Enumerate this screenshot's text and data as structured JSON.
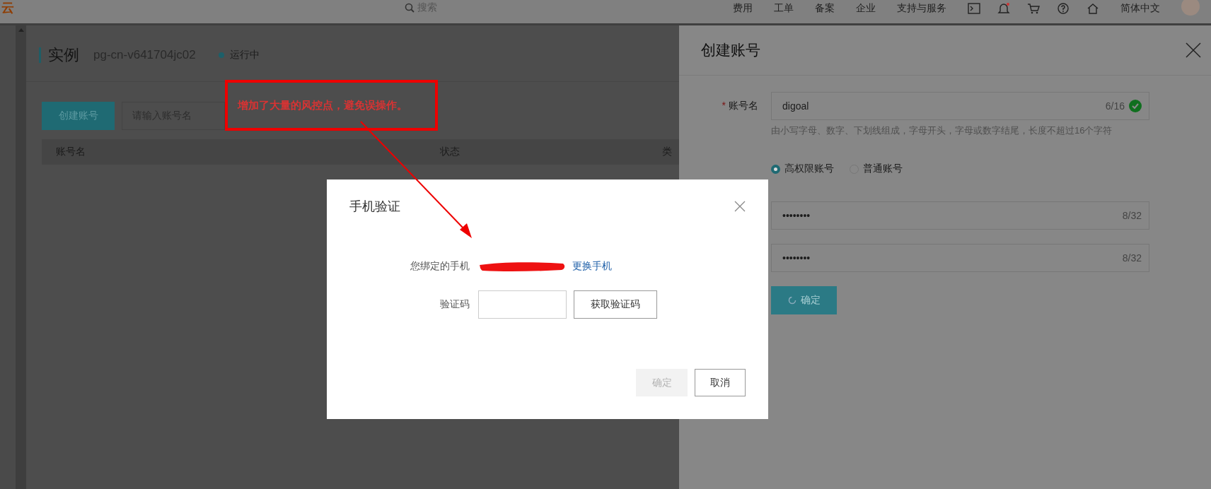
{
  "top_nav": {
    "logo": "云",
    "search_placeholder": "搜索",
    "items": [
      "费用",
      "工单",
      "备案",
      "企业",
      "支持与服务"
    ],
    "language": "简体中文"
  },
  "instance": {
    "title": "实例",
    "id": "pg-cn-v641704jc02",
    "status": "运行中"
  },
  "toolbar": {
    "create_button": "创建账号",
    "search": {
      "placeholder": "请输入账号名"
    }
  },
  "table": {
    "columns": [
      "账号名",
      "状态",
      "类"
    ]
  },
  "panel": {
    "title": "创建账号",
    "fields": [
      {
        "kind": "text",
        "label": "账号名",
        "required_mark": "*",
        "value": "digoal",
        "counter": "6/16",
        "valid": true,
        "hint": "由小写字母、数字、下划线组成，字母开头，字母或数字结尾，长度不超过16个字符"
      },
      {
        "kind": "radio",
        "options": [
          {
            "label": "高权限账号",
            "selected": true
          },
          {
            "label": "普通账号",
            "selected": false
          }
        ]
      },
      {
        "kind": "password",
        "value": "••••••••",
        "counter": "8/32"
      },
      {
        "kind": "password",
        "value": "••••••••",
        "counter": "8/32"
      }
    ],
    "submit": {
      "label": "确定",
      "loading": true
    }
  },
  "dialog": {
    "title": "手机验证",
    "phone_label": "您绑定的手机",
    "change_link": "更换手机",
    "code_label": "验证码",
    "get_code_button": "获取验证码",
    "confirm": {
      "label": "确定",
      "disabled": true
    },
    "cancel": "取消"
  },
  "annotation": {
    "text": "增加了大量的风控点，避免误操作。"
  }
}
